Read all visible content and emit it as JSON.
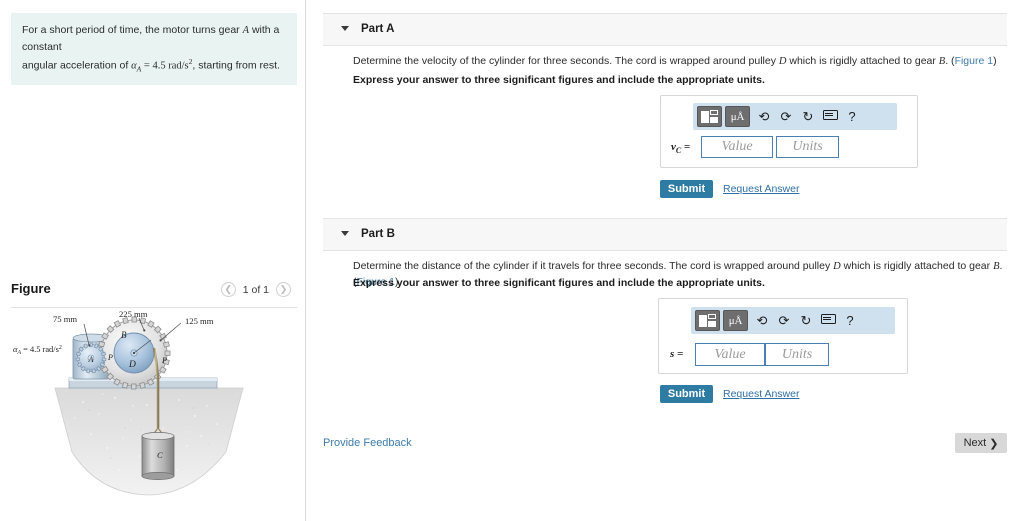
{
  "problem": {
    "line1_a": "For a short period of time, the motor turns gear ",
    "line1_var": "A",
    "line1_b": " with a constant",
    "line2_a": "angular acceleration of ",
    "line2_sym": "α",
    "line2_sub": "A",
    "line2_b": " = 4.5 rad/s",
    "line2_sup": "2",
    "line2_c": ", starting from rest."
  },
  "figure_panel": {
    "title": "Figure",
    "pager": {
      "prev_icon": "chevron-left-icon",
      "label": "1 of 1",
      "next_icon": "chevron-right-icon"
    },
    "diagram": {
      "alpha_label_sym": "α",
      "alpha_label_sub": "A",
      "alpha_label_value": " = 4.5 rad/s",
      "alpha_label_sup": "2",
      "dim_gear_a": "75 mm",
      "dim_gear_b": "225 mm",
      "dim_pulley_d": "125 mm",
      "label_a": "A",
      "label_b": "B",
      "label_d": "D",
      "label_c": "C",
      "label_p_left": "P",
      "label_p_right": "P"
    }
  },
  "parts": [
    {
      "id": "part-a",
      "caret_icon": "caret-down-icon",
      "label": "Part A",
      "question_a": "Determine the velocity of the cylinder for three seconds. The cord is wrapped around pulley ",
      "question_var1": "D",
      "question_b": " which is rigidly attached to gear ",
      "question_var2": "B",
      "question_c": ". (",
      "figure_link": "Figure 1",
      "question_d": ")",
      "instruction": "Express your answer to three significant figures and include the appropriate units.",
      "answer": {
        "variable": "v",
        "variable_sub": "C",
        "equals": "=",
        "value_placeholder": "Value",
        "units_placeholder": "Units",
        "toolbar": {
          "template_icon": "math-template-icon",
          "units_icon": "μÅ",
          "undo_icon": "undo-icon",
          "redo_icon": "redo-icon",
          "reset_icon": "reset-icon",
          "keyboard_icon": "keyboard-icon",
          "help_icon": "?"
        }
      },
      "submit_label": "Submit",
      "request_answer_label": "Request Answer"
    },
    {
      "id": "part-b",
      "caret_icon": "caret-down-icon",
      "label": "Part B",
      "question_a": "Determine the distance of the cylinder if it travels for three seconds. The cord is wrapped around pulley ",
      "question_var1": "D",
      "question_b": " which is rigidly attached to gear ",
      "question_var2": "B",
      "question_c": ". (",
      "figure_link": "Figure 1",
      "question_d": ")",
      "instruction": "Express your answer to three significant figures and include the appropriate units.",
      "answer": {
        "variable": "s",
        "variable_sub": "",
        "equals": "=",
        "value_placeholder": "Value",
        "units_placeholder": "Units",
        "toolbar": {
          "template_icon": "math-template-icon",
          "units_icon": "μÅ",
          "undo_icon": "undo-icon",
          "redo_icon": "redo-icon",
          "reset_icon": "reset-icon",
          "keyboard_icon": "keyboard-icon",
          "help_icon": "?"
        }
      },
      "submit_label": "Submit",
      "request_answer_label": "Request Answer"
    }
  ],
  "footer": {
    "feedback_label": "Provide Feedback",
    "next_label": "Next",
    "next_icon": "chevron-right-icon"
  },
  "colors": {
    "statement_bg": "#e9f4f2",
    "submit_bg": "#2e7ca4",
    "toolbar_bg": "#cfe0ef",
    "link": "#3d7ba8",
    "field_border": "#4a7fb5"
  }
}
